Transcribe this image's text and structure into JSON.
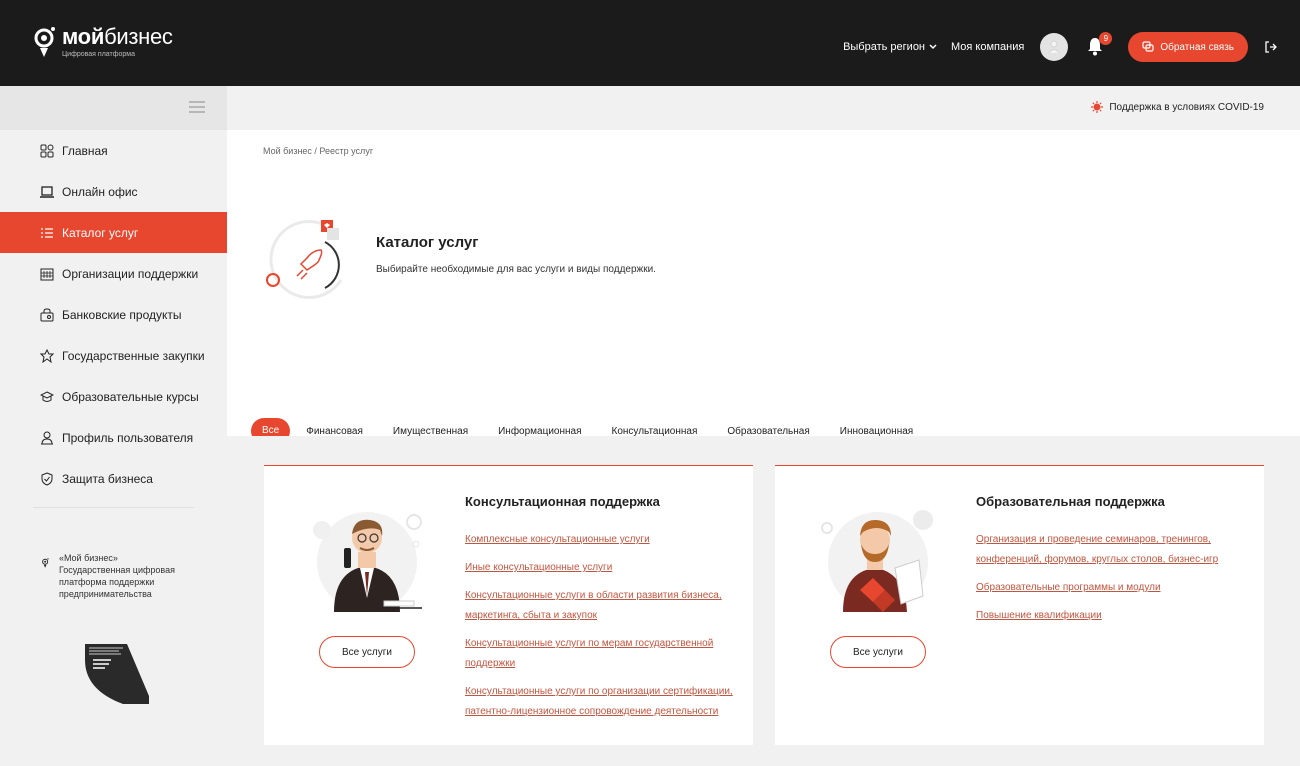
{
  "header": {
    "logo_name_bold": "мой",
    "logo_name_rest": "бизнес",
    "logo_subtitle": "Цифровая платформа",
    "region_label": "Выбрать регион",
    "company_label": "Моя компания",
    "notifications_count": "9",
    "feedback_label": "Обратная связь"
  },
  "covid_label": "Поддержка в условиях COVID-19",
  "sidebar": {
    "items": [
      {
        "label": "Главная",
        "icon": "home-grid-icon"
      },
      {
        "label": "Онлайн офис",
        "icon": "laptop-icon"
      },
      {
        "label": "Каталог услуг",
        "icon": "list-icon",
        "active": true
      },
      {
        "label": "Организации поддержки",
        "icon": "building-icon"
      },
      {
        "label": "Банковские продукты",
        "icon": "bag-icon"
      },
      {
        "label": "Государственные закупки",
        "icon": "emblem-icon"
      },
      {
        "label": "Образовательные курсы",
        "icon": "graduation-cap-icon"
      },
      {
        "label": "Профиль пользователя",
        "icon": "user-icon"
      },
      {
        "label": "Защита бизнеса",
        "icon": "shield-icon"
      }
    ],
    "info_lines": [
      "«Мой бизнес»",
      "Государственная цифровая платформа поддержки предпринимательства"
    ]
  },
  "breadcrumb": "Мой бизнес / Реестр услуг",
  "hero": {
    "title": "Каталог услуг",
    "subtitle": "Выбирайте необходимые для вас услуги и виды поддержки."
  },
  "tabs": [
    "Все",
    "Финансовая",
    "Имущественная",
    "Информационная",
    "Консультационная",
    "Образовательная",
    "Инновационная"
  ],
  "cards": [
    {
      "title": "Консультационная поддержка",
      "button": "Все услуги",
      "links": [
        "Комплексные консультационные услуги",
        "Иные консультационные услуги",
        "Консультационные услуги в области развития бизнеса, маркетинга, сбыта и закупок",
        "Консультационные услуги по мерам государственной поддержки",
        "Консультационные услуги по организации сертификации, патентно-лицензионное сопровождение деятельности"
      ]
    },
    {
      "title": "Образовательная поддержка",
      "button": "Все услуги",
      "links": [
        "Организация и проведение семинаров, тренингов, конференций, форумов, круглых столов, бизнес-игр",
        "Образовательные программы и модули",
        "Повышение квалификации"
      ]
    }
  ],
  "colors": {
    "accent": "#e8472f",
    "header_bg": "#1b1b1b",
    "link": "#c2553f"
  }
}
